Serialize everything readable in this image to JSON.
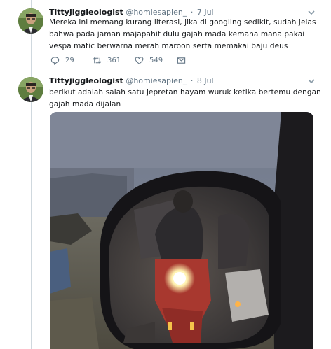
{
  "tweets": [
    {
      "name": "Tittyjiggleologist",
      "handle": "@homiesapien_",
      "separator": "·",
      "date": "7 Jul",
      "text_lines": [
        "Mereka ini memang kurang literasi, jika di googling sedikit, sudah jelas",
        "bahwa pada jaman majapahit dulu gajah mada kemana mana pakai",
        "vespa matic berwarna merah maroon serta memakai baju deus"
      ],
      "replies": "29",
      "retweets": "361",
      "likes": "549"
    },
    {
      "name": "Tittyjiggleologist",
      "handle": "@homiesapien_",
      "separator": "·",
      "date": "8 Jul",
      "text_lines": [
        "berikut adalah salah satu jepretan hayam wuruk ketika bertemu dengan",
        "gajah mada dijalan"
      ]
    }
  ],
  "icons": {
    "reply": "reply-icon",
    "retweet": "retweet-icon",
    "like": "heart-icon",
    "dm": "envelope-icon",
    "menu": "chevron-down-icon"
  },
  "colors": {
    "text": "#14171a",
    "secondary": "#657786",
    "divider": "#e6ecf0"
  }
}
